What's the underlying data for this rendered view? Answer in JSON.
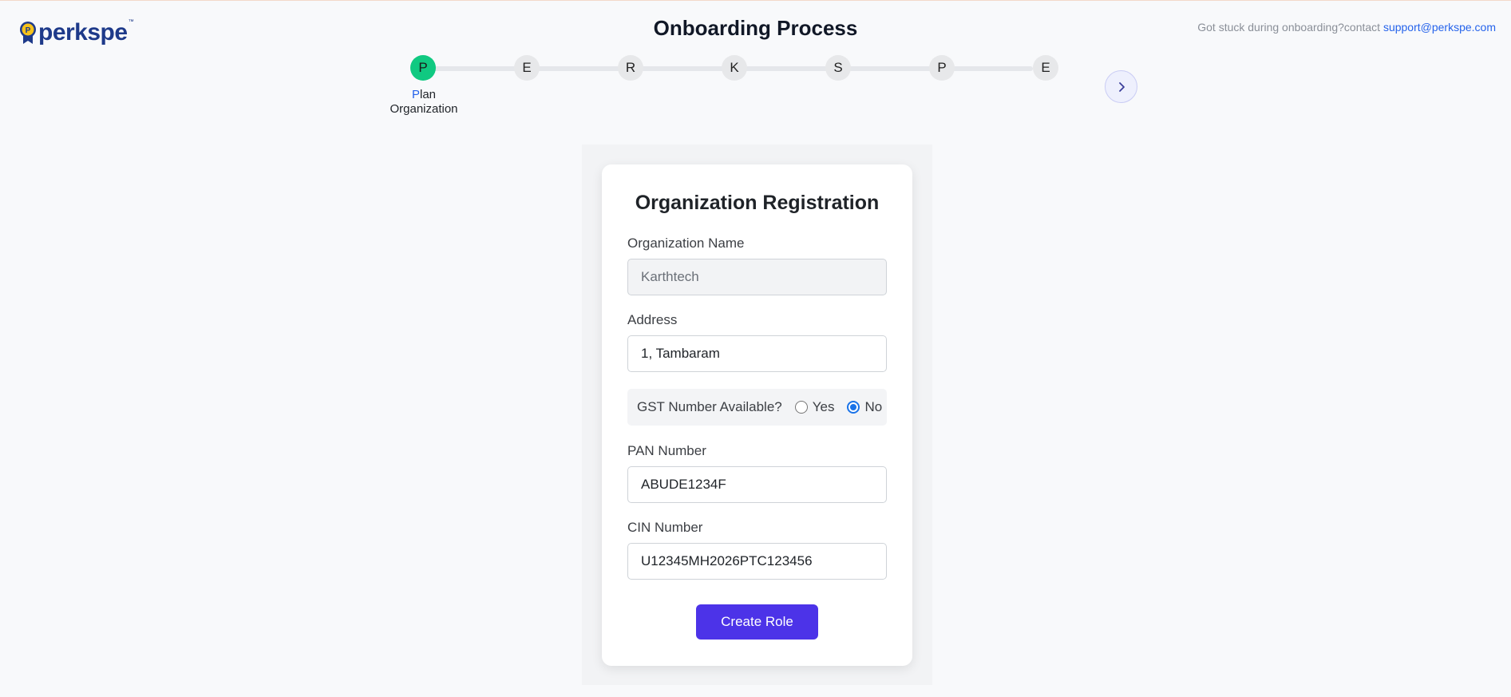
{
  "brand": {
    "logo_text": "perkspe",
    "logo_tm": "™"
  },
  "header": {
    "title": "Onboarding Process",
    "support_prefix": "Got stuck during onboarding?contact ",
    "support_email": "support@perkspe.com"
  },
  "stepper": {
    "steps": [
      "P",
      "E",
      "R",
      "K",
      "S",
      "P",
      "E"
    ],
    "active_index": 0,
    "active_label_first": "P",
    "active_label_rest": "lan",
    "active_label_line2": "Organization"
  },
  "form": {
    "title": "Organization Registration",
    "org_name_label": "Organization Name",
    "org_name_value": "Karthtech",
    "address_label": "Address",
    "address_value": "1, Tambaram",
    "gst_question": "GST Number Available?",
    "gst_yes": "Yes",
    "gst_no": "No",
    "gst_selected": "No",
    "pan_label": "PAN Number",
    "pan_value": "ABUDE1234F",
    "cin_label": "CIN Number",
    "cin_value": "U12345MH2026PTC123456",
    "submit_label": "Create Role"
  },
  "colors": {
    "accent": "#4c33e8",
    "step_active": "#10c981",
    "link": "#2563eb",
    "brand": "#1e3a8a"
  }
}
